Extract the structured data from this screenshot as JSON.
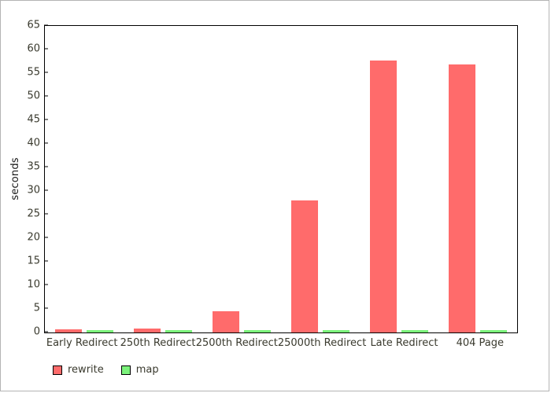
{
  "colors": {
    "rewrite": "#ff6b6b",
    "map": "#7bf27b",
    "axis": "#000000",
    "page_border": "#b4b4b4",
    "tick_text": "#3a3a2e"
  },
  "legend": {
    "position": "bottom-left",
    "items": [
      {
        "label": "rewrite",
        "color": "#ff6b6b"
      },
      {
        "label": "map",
        "color": "#7bf27b"
      }
    ]
  },
  "axes": {
    "ylabel": "seconds",
    "yticks": [
      0,
      5,
      10,
      15,
      20,
      25,
      30,
      35,
      40,
      45,
      50,
      55,
      60,
      65
    ],
    "ytick_labels": [
      "0",
      "5",
      "10",
      "15",
      "20",
      "25",
      "30",
      "35",
      "40",
      "45",
      "50",
      "55",
      "60",
      "65"
    ]
  },
  "chart_data": {
    "type": "bar",
    "title": "",
    "subtitle": "",
    "xlabel": "",
    "ylabel": "seconds",
    "ylim": [
      0,
      65
    ],
    "ytick_step": 5,
    "grid": false,
    "legend_position": "bottom-left",
    "categories": [
      "Early Redirect",
      "250th Redirect",
      "2500th Redirect",
      "25000th Redirect",
      "Late Redirect",
      "404 Page"
    ],
    "series": [
      {
        "name": "rewrite",
        "color": "#ff6b6b",
        "values": [
          0.6,
          0.8,
          4.5,
          28.0,
          57.7,
          56.8
        ]
      },
      {
        "name": "map",
        "color": "#7bf27b",
        "values": [
          0.5,
          0.5,
          0.5,
          0.5,
          0.5,
          0.5
        ]
      }
    ]
  }
}
